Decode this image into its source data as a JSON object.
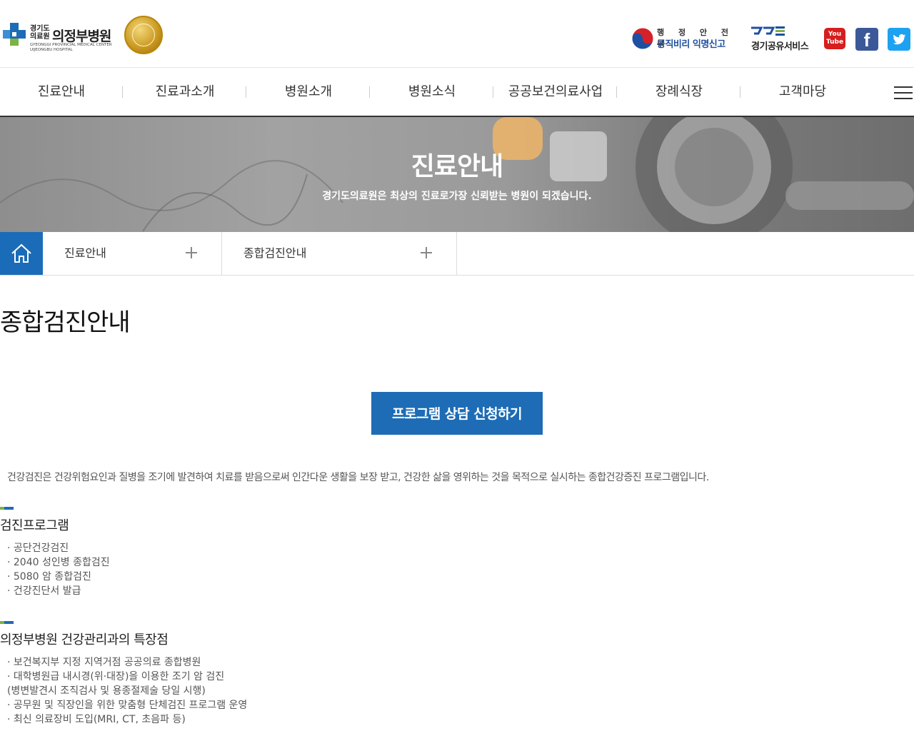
{
  "header": {
    "logo": {
      "org_small": "경기도 의료원",
      "name": "의정부병원",
      "english": "GYEONGGI PROVINCIAL MEDICAL CENTER UIJEONGBU HOSPITAL"
    },
    "gov_report": {
      "ministry": "행 정 안 전 부",
      "title": "공직비리 익명신고"
    },
    "share_service": "경기공유서비스",
    "sns": [
      "YouTube",
      "Facebook",
      "Twitter"
    ],
    "youtube_label_1": "You",
    "youtube_label_2": "Tube",
    "facebook_glyph": "f"
  },
  "gnb": {
    "items": [
      "진료안내",
      "진료과소개",
      "병원소개",
      "병원소식",
      "공공보건의료사업",
      "장례식장",
      "고객마당"
    ]
  },
  "visual": {
    "title": "진료안내",
    "subtitle": "경기도의료원은 최상의 진료로가장 신뢰받는 병원이 되겠습니다."
  },
  "location": {
    "depth1": "진료안내",
    "depth2": "종합검진안내"
  },
  "content": {
    "page_title": "종합검진안내",
    "cta_button": "프로그램 상담 신청하기",
    "intro": "건강검진은 건강위험요인과 질병을 조기에 발견하여 치료를 받음으로써 인간다운 생활을 보장 받고, 건강한 삶을 영위하는 것을 목적으로 실시하는 종합건강증진 프로그램입니다.",
    "sections": [
      {
        "title": "검진프로그램",
        "items": [
          "· 공단건강검진",
          "· 2040 성인병 종합검진",
          "· 5080 암 종합검진",
          "· 건강진단서 발급"
        ]
      },
      {
        "title": "의정부병원 건강관리과의 특장점",
        "items": [
          "· 보건복지부 지정 지역거점 공공의료 종합병원",
          "· 대학병원급 내시경(위·대장)을 이용한 조기 암 검진",
          "(병변발견시 조직검사 및 용종절제술 당일 시행)",
          "· 공무원 및 직장인을 위한 맞춤형 단체검진 프로그램 운영",
          "· 최신 의료장비 도입(MRI, CT, 초음파 등)"
        ]
      }
    ]
  },
  "colors": {
    "brand_blue": "#1d6cb5",
    "accent_green": "#7cb342",
    "home_blue": "#1a6cb8"
  }
}
